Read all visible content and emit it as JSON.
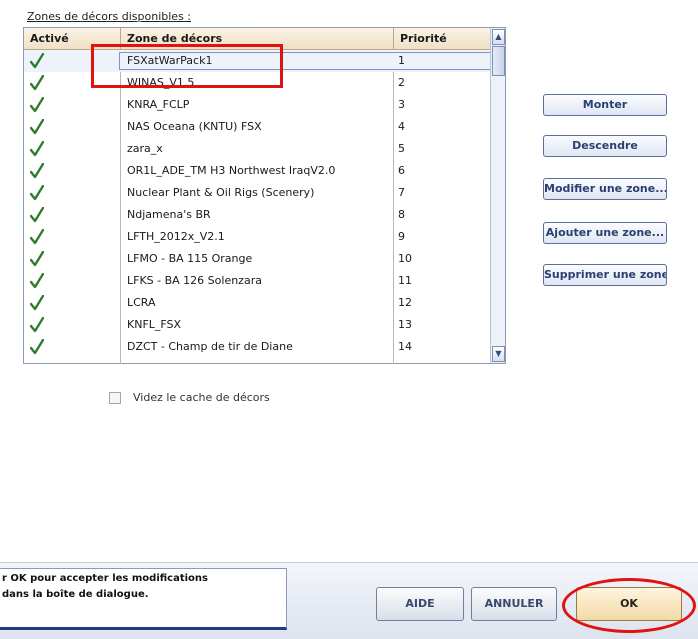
{
  "section_label": "Zones de décors disponibles :",
  "table": {
    "columns": [
      "Activé",
      "Zone de décors",
      "Priorité"
    ],
    "rows": [
      {
        "active": true,
        "name": "FSXatWarPack1",
        "priority": "1",
        "selected": true
      },
      {
        "active": true,
        "name": "WINAS_V1.5",
        "priority": "2"
      },
      {
        "active": true,
        "name": "KNRA_FCLP",
        "priority": "3"
      },
      {
        "active": true,
        "name": "NAS Oceana (KNTU) FSX",
        "priority": "4"
      },
      {
        "active": true,
        "name": "zara_x",
        "priority": "5"
      },
      {
        "active": true,
        "name": "OR1L_ADE_TM H3 Northwest IraqV2.0",
        "priority": "6"
      },
      {
        "active": true,
        "name": "Nuclear Plant & Oil Rigs (Scenery)",
        "priority": "7"
      },
      {
        "active": true,
        "name": "Ndjamena's BR",
        "priority": "8"
      },
      {
        "active": true,
        "name": "LFTH_2012x_V2.1",
        "priority": "9"
      },
      {
        "active": true,
        "name": "LFMO - BA 115 Orange",
        "priority": "10"
      },
      {
        "active": true,
        "name": "LFKS - BA 126 Solenzara",
        "priority": "11"
      },
      {
        "active": true,
        "name": "LCRA",
        "priority": "12"
      },
      {
        "active": true,
        "name": "KNFL_FSX",
        "priority": "13"
      },
      {
        "active": true,
        "name": "DZCT - Champ de tir de Diane",
        "priority": "14"
      }
    ]
  },
  "buttons": {
    "monter": "Monter",
    "descendre": "Descendre",
    "modifier": "Modifier une zone...",
    "ajouter": "Ajouter une zone...",
    "supprimer": "Supprimer une zone"
  },
  "cache_checkbox": {
    "label": "Videz le cache de décors",
    "checked": false
  },
  "help_text": {
    "line1": "r OK pour accepter les modifications",
    "line2": "dans la boîte de dialogue."
  },
  "bottom_buttons": {
    "aide": "AIDE",
    "annuler": "ANNULER",
    "ok": "OK"
  },
  "colors": {
    "annotation": "#e01313",
    "check": "#2e7d2e",
    "selection": "#eef3fb"
  }
}
